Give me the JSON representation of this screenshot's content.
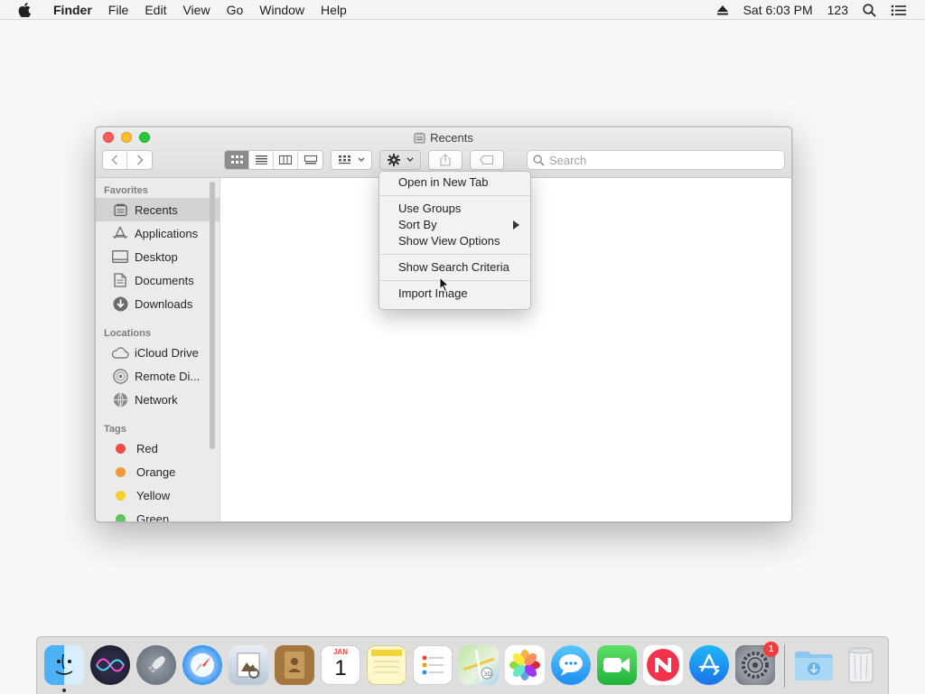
{
  "menubar": {
    "app_name": "Finder",
    "menus": [
      "File",
      "Edit",
      "View",
      "Go",
      "Window",
      "Help"
    ],
    "clock": "Sat 6:03 PM",
    "input_source": "123"
  },
  "window": {
    "title": "Recents",
    "search_placeholder": "Search"
  },
  "sidebar": {
    "favorites_header": "Favorites",
    "favorites": [
      {
        "label": "Recents",
        "icon": "recents-icon",
        "selected": true
      },
      {
        "label": "Applications",
        "icon": "applications-icon"
      },
      {
        "label": "Desktop",
        "icon": "desktop-icon"
      },
      {
        "label": "Documents",
        "icon": "documents-icon"
      },
      {
        "label": "Downloads",
        "icon": "downloads-icon"
      }
    ],
    "locations_header": "Locations",
    "locations": [
      {
        "label": "iCloud Drive",
        "icon": "cloud-icon"
      },
      {
        "label": "Remote Di...",
        "icon": "disc-icon"
      },
      {
        "label": "Network",
        "icon": "network-icon"
      }
    ],
    "tags_header": "Tags",
    "tags": [
      {
        "label": "Red",
        "color": "#ec4b4b"
      },
      {
        "label": "Orange",
        "color": "#f09a37"
      },
      {
        "label": "Yellow",
        "color": "#f5d033"
      },
      {
        "label": "Green",
        "color": "#5dc35a"
      }
    ]
  },
  "context_menu": {
    "items": [
      "Open in New Tab",
      "Use Groups",
      "Sort By",
      "Show View Options",
      "Show Search Criteria",
      "Import Image"
    ]
  },
  "dock": {
    "apps": [
      "Finder",
      "Siri",
      "Launchpad",
      "Safari",
      "Preview",
      "Contacts",
      "Calendar",
      "Notes",
      "Reminders",
      "Maps",
      "Photos",
      "Messages",
      "FaceTime",
      "News",
      "App Store",
      "System Preferences",
      "Downloads",
      "Trash"
    ],
    "calendar_month": "JAN",
    "calendar_day": "1",
    "system_prefs_badge": "1"
  }
}
